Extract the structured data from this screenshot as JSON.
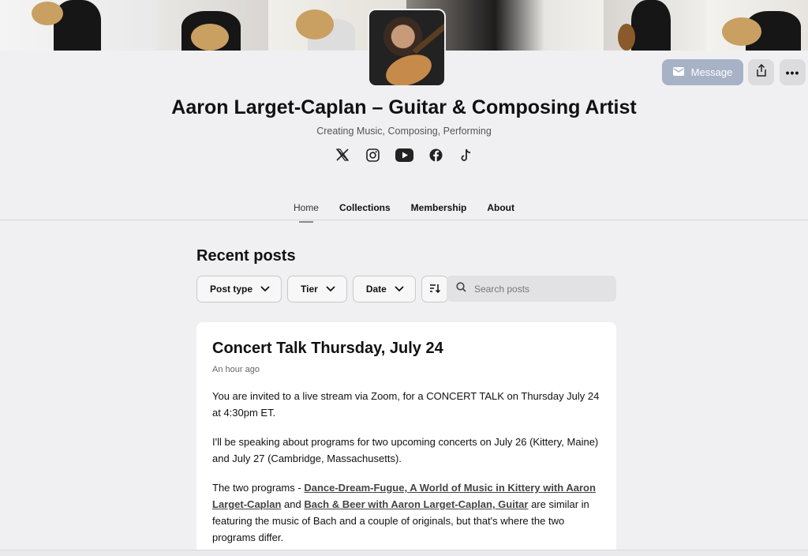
{
  "creator": {
    "name": "Aaron Larget-Caplan – Guitar & Composing Artist",
    "tagline": "Creating Music, Composing, Performing"
  },
  "actions": {
    "message_label": "Message",
    "more_label": "•••"
  },
  "social": [
    "x-icon",
    "instagram-icon",
    "youtube-icon",
    "facebook-icon",
    "tiktok-icon"
  ],
  "nav": {
    "tabs": [
      {
        "label": "Home",
        "active": true
      },
      {
        "label": "Collections",
        "active": false
      },
      {
        "label": "Membership",
        "active": false
      },
      {
        "label": "About",
        "active": false
      }
    ]
  },
  "recent": {
    "heading": "Recent posts",
    "filters": [
      "Post type",
      "Tier",
      "Date"
    ],
    "search_placeholder": "Search posts"
  },
  "post": {
    "title": "Concert Talk Thursday, July 24",
    "time": "An hour ago",
    "p1": "You are invited to a live stream via Zoom, for a CONCERT TALK on Thursday July 24 at 4:30pm ET.",
    "p2": "I'll be speaking about programs for two upcoming concerts on July 26 (Kittery, Maine) and July 27 (Cambridge, Massachusetts).",
    "p3_start": "The two programs - ",
    "link1": "Dance-Dream-Fugue, A World of Music in Kittery with Aaron Larget-Caplan",
    "p3_mid": " and ",
    "link2": "Bach & Beer with Aaron Larget-Caplan, Guitar",
    "p3_end": " are similar in featuring the music of Bach and a couple of originals, but that's where the two programs differ."
  },
  "colors": {
    "message_button": "#a7b2c7",
    "background": "#f0f0f2",
    "card": "#ffffff"
  }
}
